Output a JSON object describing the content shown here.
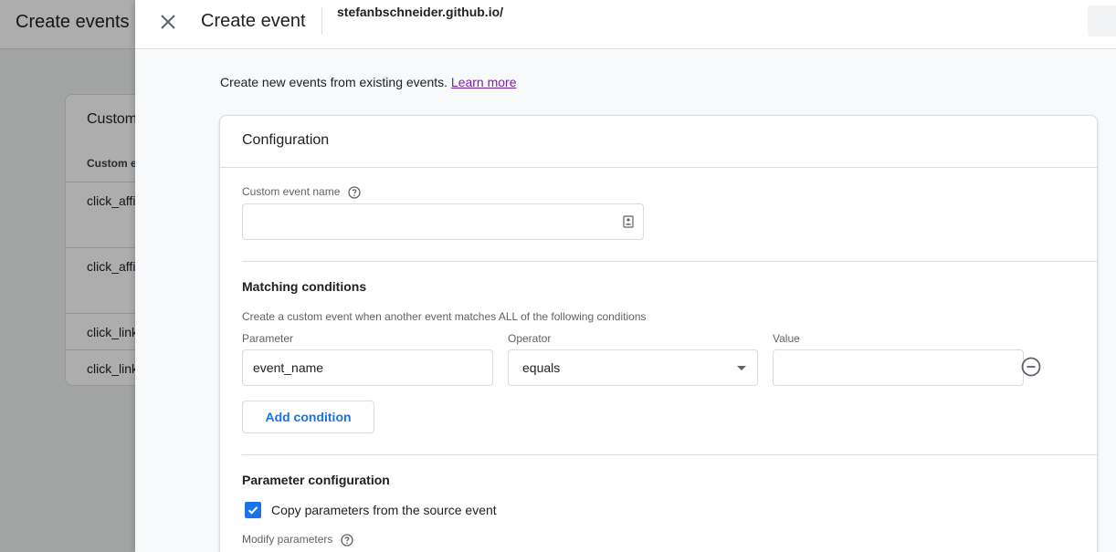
{
  "background": {
    "title": "Create events",
    "card_title": "Custom events",
    "column_header": "Custom event name",
    "rows": [
      "click_affiliate_link",
      "click_affiliate_button",
      "click_link_internal",
      "click_link_external"
    ]
  },
  "panel": {
    "title": "Create event",
    "property": "stefanbschneider.github.io/",
    "intro_text": "Create new events from existing events.",
    "learn_more": "Learn more"
  },
  "configuration": {
    "title": "Configuration",
    "custom_event_name_label": "Custom event name",
    "custom_event_name_value": "",
    "matching": {
      "title": "Matching conditions",
      "description": "Create a custom event when another event matches ALL of the following conditions",
      "parameter_label": "Parameter",
      "operator_label": "Operator",
      "value_label": "Value",
      "parameter_value": "event_name",
      "operator_value": "equals",
      "value_value": "",
      "add_condition": "Add condition"
    },
    "parameter_configuration": {
      "title": "Parameter configuration",
      "copy_label": "Copy parameters from the source event",
      "copy_checked": true,
      "modify_label": "Modify parameters"
    }
  },
  "colors": {
    "accent": "#1a73e8",
    "link": "#7b1fa2",
    "border": "#dadce0"
  },
  "icons": {
    "close": "close-icon",
    "help": "help-circle-icon",
    "input": "contact-card-icon",
    "remove": "remove-circle-icon",
    "check": "check-icon",
    "caret": "dropdown-caret-icon"
  }
}
